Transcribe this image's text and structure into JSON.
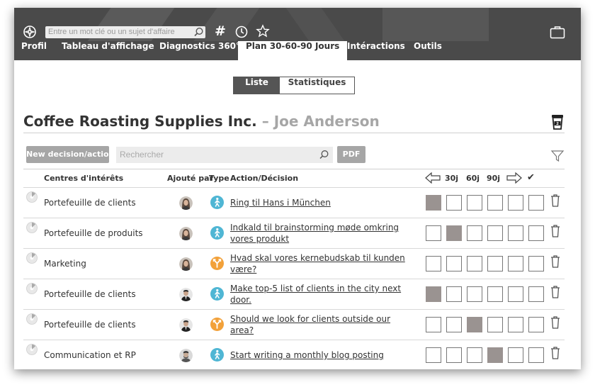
{
  "topbar": {
    "search_placeholder": "Entre un mot clé ou un sujet d'affaire",
    "icons": [
      "compass-icon",
      "search-icon",
      "hashtag-icon",
      "history-icon",
      "star-icon",
      "briefcase-icon"
    ]
  },
  "nav": {
    "items": [
      {
        "label": "Profil",
        "active": false
      },
      {
        "label": "Tableau d'affichage",
        "active": false
      },
      {
        "label": "Diagnostics 360°",
        "active": false
      },
      {
        "label": "Plan 30-60-90 Jours",
        "active": true
      },
      {
        "label": "Intéractions",
        "active": false
      },
      {
        "label": "Outils",
        "active": false
      }
    ]
  },
  "view_toggle": {
    "list": "Liste",
    "stats": "Statistiques",
    "selected": "Liste"
  },
  "header": {
    "company": "Coffee Roasting Supplies Inc.",
    "separator": "–",
    "person": "Joe Anderson"
  },
  "toolbar": {
    "new_button": "New decision/action",
    "search_placeholder": "Rechercher",
    "pdf_button": "PDF"
  },
  "table": {
    "headers": {
      "center": "Centres d'intérêts",
      "added_by": "Ajouté par",
      "type": "Type",
      "action": "Action/Décision",
      "d30": "30j",
      "d60": "60j",
      "d90": "90j",
      "done": "✔"
    },
    "rows": [
      {
        "center": "Portefeuille de clients",
        "action": "Ring til Hans i München",
        "type": "person",
        "avatar": "woman",
        "filled_slot": 0
      },
      {
        "center": "Portefeuille de produits",
        "action": "Indkald til brainstorming møde omkring vores produkt",
        "type": "person",
        "avatar": "woman",
        "filled_slot": 1
      },
      {
        "center": "Marketing",
        "action": "Hvad skal vores kernebudskab til kunden være?",
        "type": "decision",
        "avatar": "woman",
        "filled_slot": -1
      },
      {
        "center": "Portefeuille de clients",
        "action": "Make top-5 list of clients in the city next door.",
        "type": "person",
        "avatar": "man-suit",
        "filled_slot": 0
      },
      {
        "center": "Portefeuille de clients",
        "action": "Should we look for clients outside our area?",
        "type": "decision",
        "avatar": "man-suit",
        "filled_slot": 2
      },
      {
        "center": "Communication et RP",
        "action": "Start writing a monthly blog posting",
        "type": "person",
        "avatar": "man-beard",
        "filled_slot": 3
      }
    ]
  },
  "colors": {
    "topbar": "#4a4a4a",
    "type_person": "#4fb6d4",
    "type_decision": "#f2a13a",
    "filled_box": "#9a9391",
    "button_gray": "#a6a6a6"
  }
}
